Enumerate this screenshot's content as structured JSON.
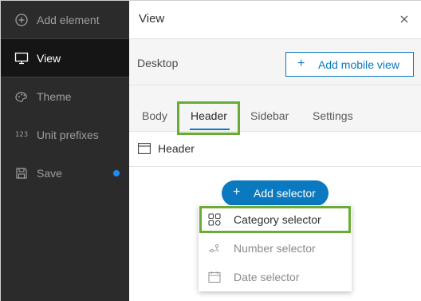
{
  "sidebar": {
    "items": [
      {
        "label": "Add element",
        "icon": "plus-circle-icon"
      },
      {
        "label": "View",
        "icon": "desktop-icon"
      },
      {
        "label": "Theme",
        "icon": "palette-icon"
      },
      {
        "label": "Unit prefixes",
        "icon": "unit-123-icon"
      },
      {
        "label": "Save",
        "icon": "save-icon"
      }
    ],
    "unit_icon_text": "123",
    "accent_color": "#1e8cf5"
  },
  "panel": {
    "title": "View",
    "device_label": "Desktop",
    "add_mobile_label": "Add mobile view",
    "tabs": [
      {
        "label": "Body"
      },
      {
        "label": "Header"
      },
      {
        "label": "Sidebar"
      },
      {
        "label": "Settings"
      }
    ],
    "active_tab": "Header",
    "section_label": "Header",
    "add_selector_label": "Add selector",
    "menu_items": [
      {
        "label": "Category selector",
        "icon": "category-grid-icon"
      },
      {
        "label": "Number selector",
        "icon": "number-slider-icon"
      },
      {
        "label": "Date selector",
        "icon": "calendar-icon"
      }
    ],
    "primary_color": "#0a79bf",
    "highlight_color": "#6aab35"
  }
}
